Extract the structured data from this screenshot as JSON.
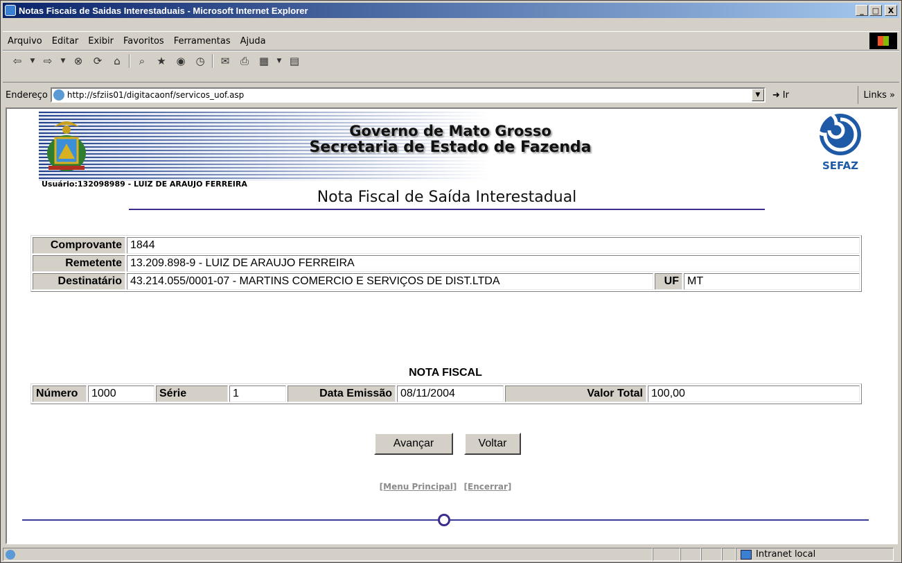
{
  "window": {
    "title": "Notas Fiscais de Saidas Interestaduais - Microsoft Internet Explorer",
    "controls": [
      "_",
      "□",
      "X"
    ]
  },
  "menu": [
    "Arquivo",
    "Editar",
    "Exibir",
    "Favoritos",
    "Ferramentas",
    "Ajuda"
  ],
  "address": {
    "label": "Endereço",
    "url": "http://sfziis01/digitacaonf/servicos_uof.asp",
    "go": "Ir",
    "links": "Links »"
  },
  "header": {
    "line1": "Governo de Mato Grosso",
    "line2": "Secretaria de Estado de Fazenda",
    "logo_text": "SEFAZ",
    "usuario": "Usuário:132098989 - LUIZ DE ARAUJO FERREIRA"
  },
  "page_title": "Nota Fiscal de Saída Interestadual",
  "info": {
    "comprovante_label": "Comprovante",
    "comprovante_value": "1844",
    "remetente_label": "Remetente",
    "remetente_value": "13.209.898-9 - LUIZ DE ARAUJO FERREIRA",
    "destinatario_label": "Destinatário",
    "destinatario_value": "43.214.055/0001-07 - MARTINS COMERCIO E SERVIÇOS DE DIST.LTDA",
    "uf_label": "UF",
    "uf_value": "MT"
  },
  "nota_fiscal": {
    "title": "NOTA FISCAL",
    "numero_label": "Número",
    "numero_value": "1000",
    "serie_label": "Série",
    "serie_value": "1",
    "data_label": "Data Emissão",
    "data_value": "08/11/2004",
    "valor_label": "Valor Total",
    "valor_value": "100,00"
  },
  "buttons": {
    "avancar": "Avançar",
    "voltar": "Voltar"
  },
  "nav_links": {
    "menu_principal": "[Menu Principal]",
    "encerrar": "[Encerrar]"
  },
  "status": {
    "zone": "Intranet local"
  }
}
